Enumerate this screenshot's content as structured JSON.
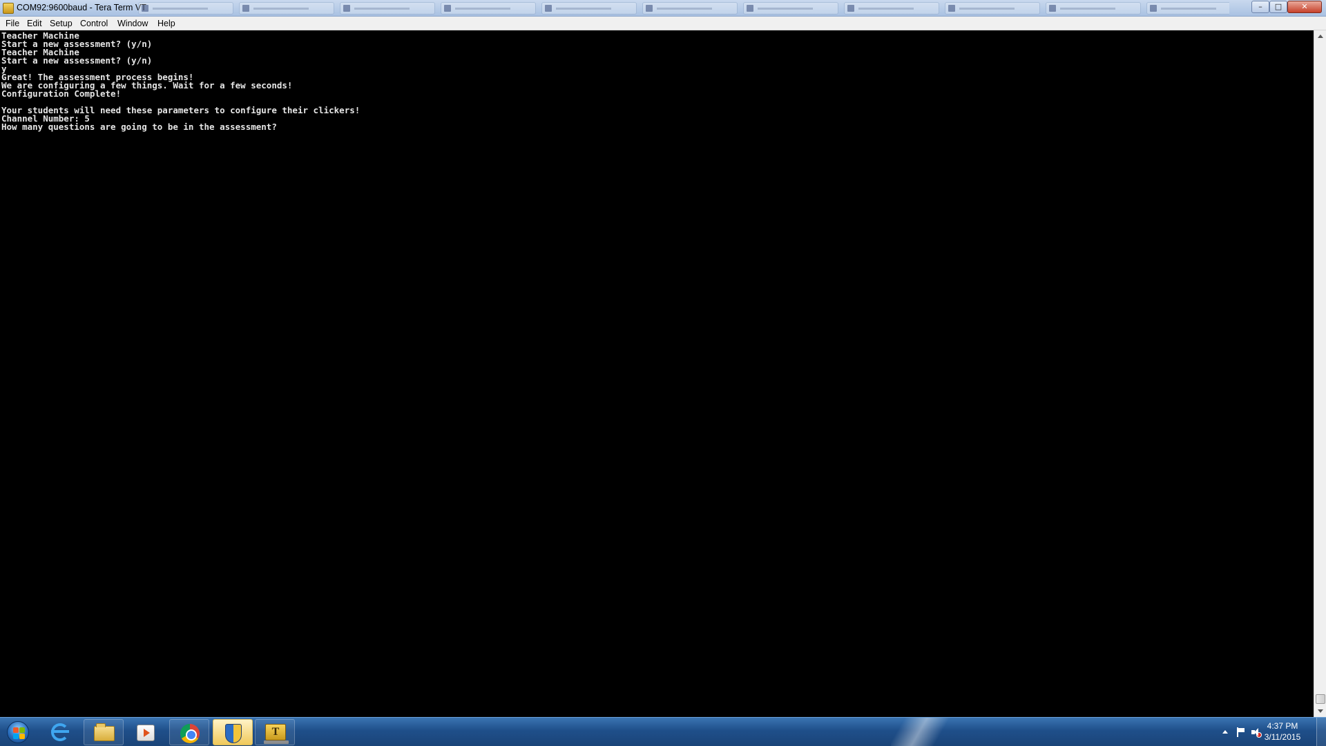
{
  "window": {
    "title": "COM92:9600baud - Tera Term VT",
    "app_icon": "tera-term-icon",
    "controls": {
      "minimize": "–",
      "maximize": "□",
      "close": "✕"
    }
  },
  "menu": [
    {
      "label": "File"
    },
    {
      "label": "Edit"
    },
    {
      "label": "Setup"
    },
    {
      "label": "Control"
    },
    {
      "label": "Window"
    },
    {
      "label": "Help"
    }
  ],
  "terminal": {
    "background": "#000000",
    "foreground": "#e6e6e6",
    "lines": [
      "Teacher Machine",
      "Start a new assessment? (y/n)",
      "Teacher Machine",
      "Start a new assessment? (y/n)",
      "y",
      "Great! The assessment process begins!",
      "We are configuring a few things. Wait for a few seconds!",
      "Configuration Complete!",
      "",
      "Your students will need these parameters to configure their clickers!",
      "Channel Number: 5",
      "How many questions are going to be in the assessment?"
    ]
  },
  "taskbar": {
    "buttons": [
      {
        "name": "internet-explorer",
        "icon": "ie-icon"
      },
      {
        "name": "windows-explorer",
        "icon": "folder-icon"
      },
      {
        "name": "media-player",
        "icon": "media-player-icon"
      },
      {
        "name": "chrome",
        "icon": "chrome-icon"
      },
      {
        "name": "security-center",
        "icon": "shield-icon"
      },
      {
        "name": "tera-term",
        "icon": "tera-term-icon",
        "active": true
      }
    ],
    "tray_icons": [
      "show-hidden-icons-arrow",
      "action-center-flag-icon",
      "volume-muted-icon"
    ],
    "clock": {
      "time": "4:37 PM",
      "date": "3/11/2015"
    }
  }
}
